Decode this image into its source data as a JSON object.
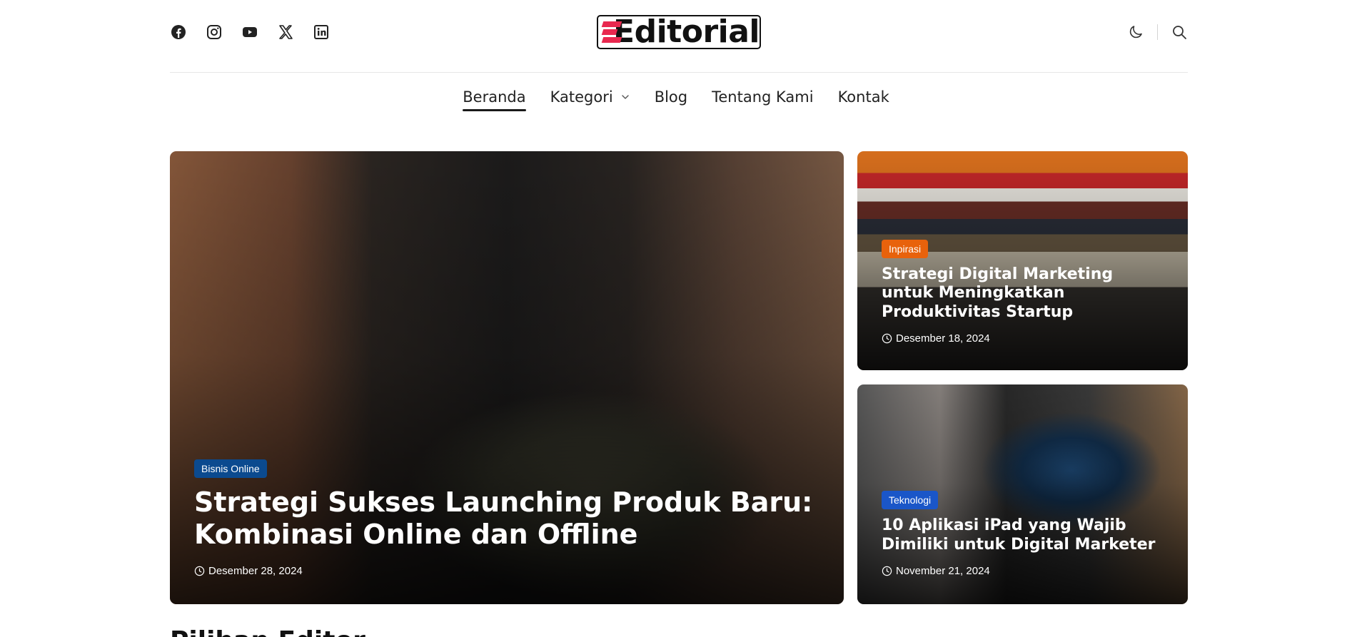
{
  "header": {
    "logo_text": "Editorial",
    "socials": [
      "facebook-icon",
      "instagram-icon",
      "youtube-icon",
      "x-icon",
      "linkedin-icon"
    ],
    "tools": [
      "moon-icon",
      "search-icon"
    ]
  },
  "nav": {
    "items": [
      {
        "label": "Beranda",
        "active": true
      },
      {
        "label": "Kategori",
        "has_dropdown": true
      },
      {
        "label": "Blog"
      },
      {
        "label": "Tentang Kami"
      },
      {
        "label": "Kontak"
      }
    ]
  },
  "featured": {
    "main": {
      "category": "Bisnis Online",
      "category_color": "#0b4a8f",
      "title": "Strategi Sukses Launching Produk Baru: Kombinasi Online dan Offline",
      "date": "Desember 28, 2024"
    },
    "side": [
      {
        "category": "Inpirasi",
        "category_color": "#e8620c",
        "title": "Strategi Digital Marketing untuk Meningkatkan Produktivitas Startup",
        "date": "Desember 18, 2024"
      },
      {
        "category": "Teknologi",
        "category_color": "#1a56c8",
        "title": "10 Aplikasi iPad yang Wajib Dimiliki untuk Digital Marketer",
        "date": "November 21, 2024"
      }
    ]
  },
  "section": {
    "title": "Pilihan Editor"
  },
  "colors": {
    "logo_accent": "#e8284f",
    "text": "#1c1c1c"
  }
}
